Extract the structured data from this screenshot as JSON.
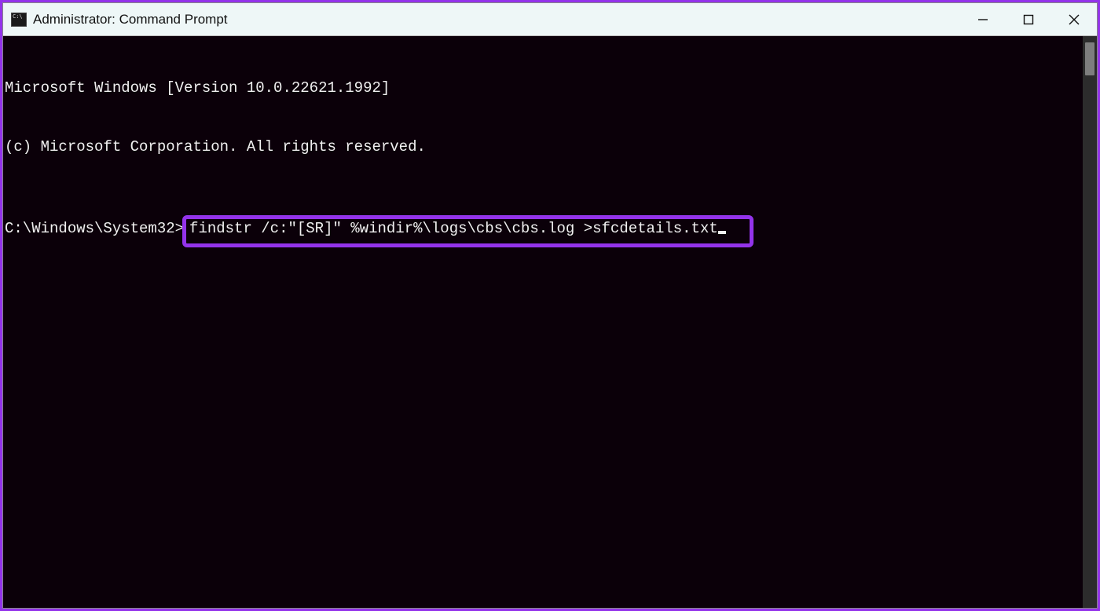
{
  "titlebar": {
    "title": "Administrator: Command Prompt"
  },
  "console": {
    "line1": "Microsoft Windows [Version 10.0.22621.1992]",
    "line2": "(c) Microsoft Corporation. All rights reserved.",
    "prompt": "C:\\Windows\\System32>",
    "command": "findstr /c:\"[SR]\" %windir%\\logs\\cbs\\cbs.log >sfcdetails.txt"
  },
  "colors": {
    "highlight_border": "#9333ea",
    "console_bg": "#0b0009",
    "console_fg": "#f0f0f0",
    "titlebar_bg": "#eef7f7"
  }
}
